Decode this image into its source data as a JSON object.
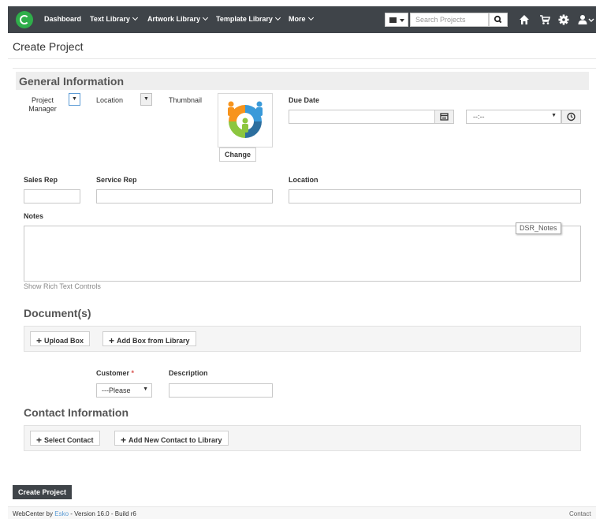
{
  "nav": {
    "items": [
      {
        "label": "Dashboard",
        "caret": false
      },
      {
        "label": "Text Library",
        "caret": true
      },
      {
        "label": "Artwork Library",
        "caret": true
      },
      {
        "label": "Template Library",
        "caret": true
      },
      {
        "label": "More",
        "caret": true
      }
    ],
    "search_placeholder": "Search Projects",
    "icons": [
      "search-icon",
      "home-icon",
      "cart-icon",
      "gear-icon",
      "user-icon"
    ],
    "bar_color": "#3f4449",
    "logo_color": "#2fae4a"
  },
  "page": {
    "title": "Create Project"
  },
  "general": {
    "title": "General Information",
    "project_manager_label": "Project Manager",
    "location_label_small": "Location",
    "thumbnail_label": "Thumbnail",
    "change_button": "Change",
    "due_date_label": "Due Date",
    "time_value": "--:--",
    "sales_rep_label": "Sales Rep",
    "service_rep_label": "Service Rep",
    "location_label": "Location",
    "notes_label": "Notes",
    "notes_tag": "DSR_Notes",
    "rich_text_link": "Show Rich Text Controls"
  },
  "documents": {
    "title": "Document(s)",
    "upload_button": "Upload Box",
    "add_box_button": "Add Box from Library",
    "customer_label": "Customer",
    "required_mark": "*",
    "customer_value": "---Please",
    "description_label": "Description"
  },
  "contact": {
    "title": "Contact Information",
    "select_button": "Select Contact",
    "add_new_button": "Add New Contact to Library"
  },
  "footer": {
    "create_button": "Create Project",
    "webcenter_by": "WebCenter by",
    "esko": "Esko",
    "version": "- Version  16.0 - Build  r6",
    "contact": "Contact"
  }
}
